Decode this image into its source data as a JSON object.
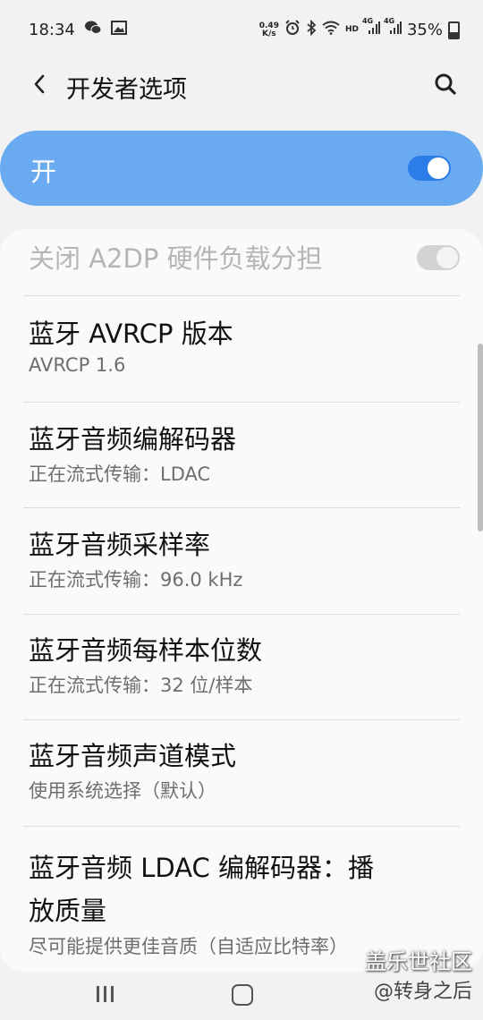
{
  "status_bar": {
    "time": "18:34",
    "net_speed_top": "0.49",
    "net_speed_bottom": "K/s",
    "hd": "HD",
    "net1": "4G",
    "net2": "4G",
    "battery": "35%"
  },
  "header": {
    "title": "开发者选项"
  },
  "master_switch": {
    "label": "开",
    "state": "on"
  },
  "settings": {
    "items": [
      {
        "label": "关闭 A2DP 硬件负载分担"
      },
      {
        "label": "蓝牙 AVRCP 版本",
        "value": "AVRCP 1.6"
      },
      {
        "label": "蓝牙音频编解码器",
        "value": "正在流式传输：LDAC"
      },
      {
        "label": "蓝牙音频采样率",
        "value": "正在流式传输：96.0 kHz"
      },
      {
        "label": "蓝牙音频每样本位数",
        "value": "正在流式传输：32 位/样本"
      },
      {
        "label": "蓝牙音频声道模式",
        "value": "使用系统选择（默认）"
      },
      {
        "label_line1": "蓝牙音频 LDAC 编解码器：播",
        "label_line2": "放质量",
        "value": "尽可能提供更佳音质（自适应比特率）"
      }
    ]
  },
  "watermark": {
    "line1": "盖乐世社区",
    "line2": "@转身之后"
  },
  "colors": {
    "accent": "#2c7de8",
    "master_bg": "#6aaaf0"
  }
}
